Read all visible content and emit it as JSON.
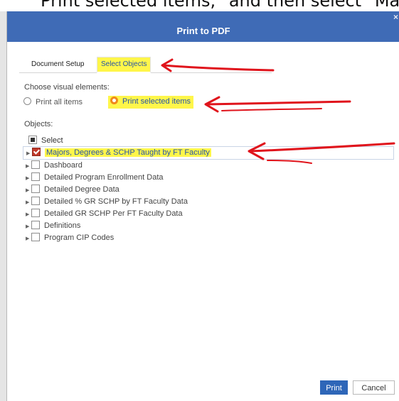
{
  "caption": {
    "text": "\"Print selected items,\" and then select \"Ma"
  },
  "dialog": {
    "title": "Print to PDF",
    "close_glyph": "×",
    "tabs": [
      {
        "label": "Document Setup",
        "active": false
      },
      {
        "label": "Select Objects",
        "active": true,
        "highlighted": true
      }
    ],
    "visual_elements_label": "Choose visual elements:",
    "radio_options": [
      {
        "label": "Print all items",
        "checked": false
      },
      {
        "label": "Print selected items",
        "checked": true,
        "highlighted": true
      }
    ],
    "objects_label": "Objects:",
    "select_all_label": "Select",
    "select_all_state": "indeterminate",
    "objects": [
      {
        "label": "Majors, Degrees & SCHP Taught by FT Faculty",
        "checked": true,
        "highlighted": true
      },
      {
        "label": "Dashboard",
        "checked": false
      },
      {
        "label": "Detailed Program Enrollment Data",
        "checked": false
      },
      {
        "label": "Detailed Degree Data",
        "checked": false
      },
      {
        "label": "Detailed % GR SCHP by FT Faculty Data",
        "checked": false
      },
      {
        "label": "Detailed GR SCHP Per FT Faculty Data",
        "checked": false
      },
      {
        "label": "Definitions",
        "checked": false
      },
      {
        "label": "Program CIP Codes",
        "checked": false
      }
    ],
    "buttons": {
      "print": "Print",
      "cancel": "Cancel"
    }
  },
  "colors": {
    "title_bar": "#3f6bb6",
    "highlight": "#fff64a",
    "annotation_arrow": "#e0141c",
    "primary_button": "#2e66b8",
    "radio_checked": "#f08a1c"
  },
  "annotations": {
    "arrow_icon": "red-hand-drawn-arrow",
    "arrow_count": 3
  }
}
